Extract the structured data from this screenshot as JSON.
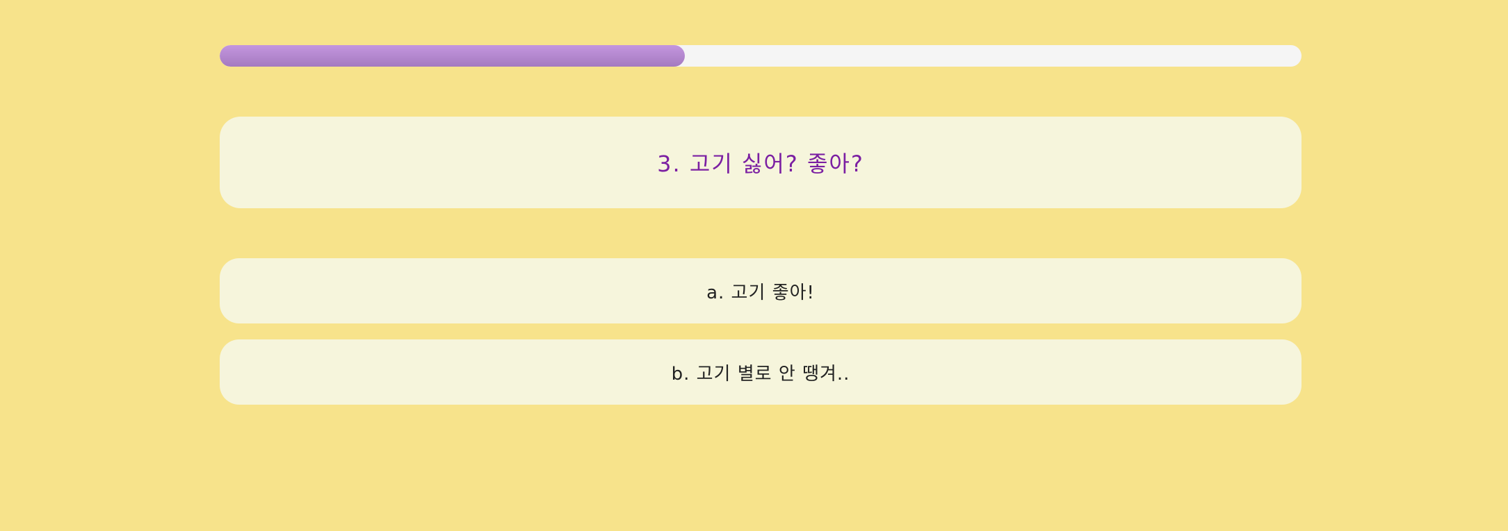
{
  "progress": {
    "value": 0.43,
    "fill_color": "#b287cf",
    "track_color": "#f5f5f5"
  },
  "question": {
    "text": "3. 고기 싫어? 좋아?",
    "color": "#7b1fa2"
  },
  "answers": [
    {
      "label": "a. 고기 좋아!"
    },
    {
      "label": "b. 고기 별로 안 땡겨.."
    }
  ],
  "colors": {
    "background": "#f7e38b",
    "card": "#f6f5dc"
  }
}
